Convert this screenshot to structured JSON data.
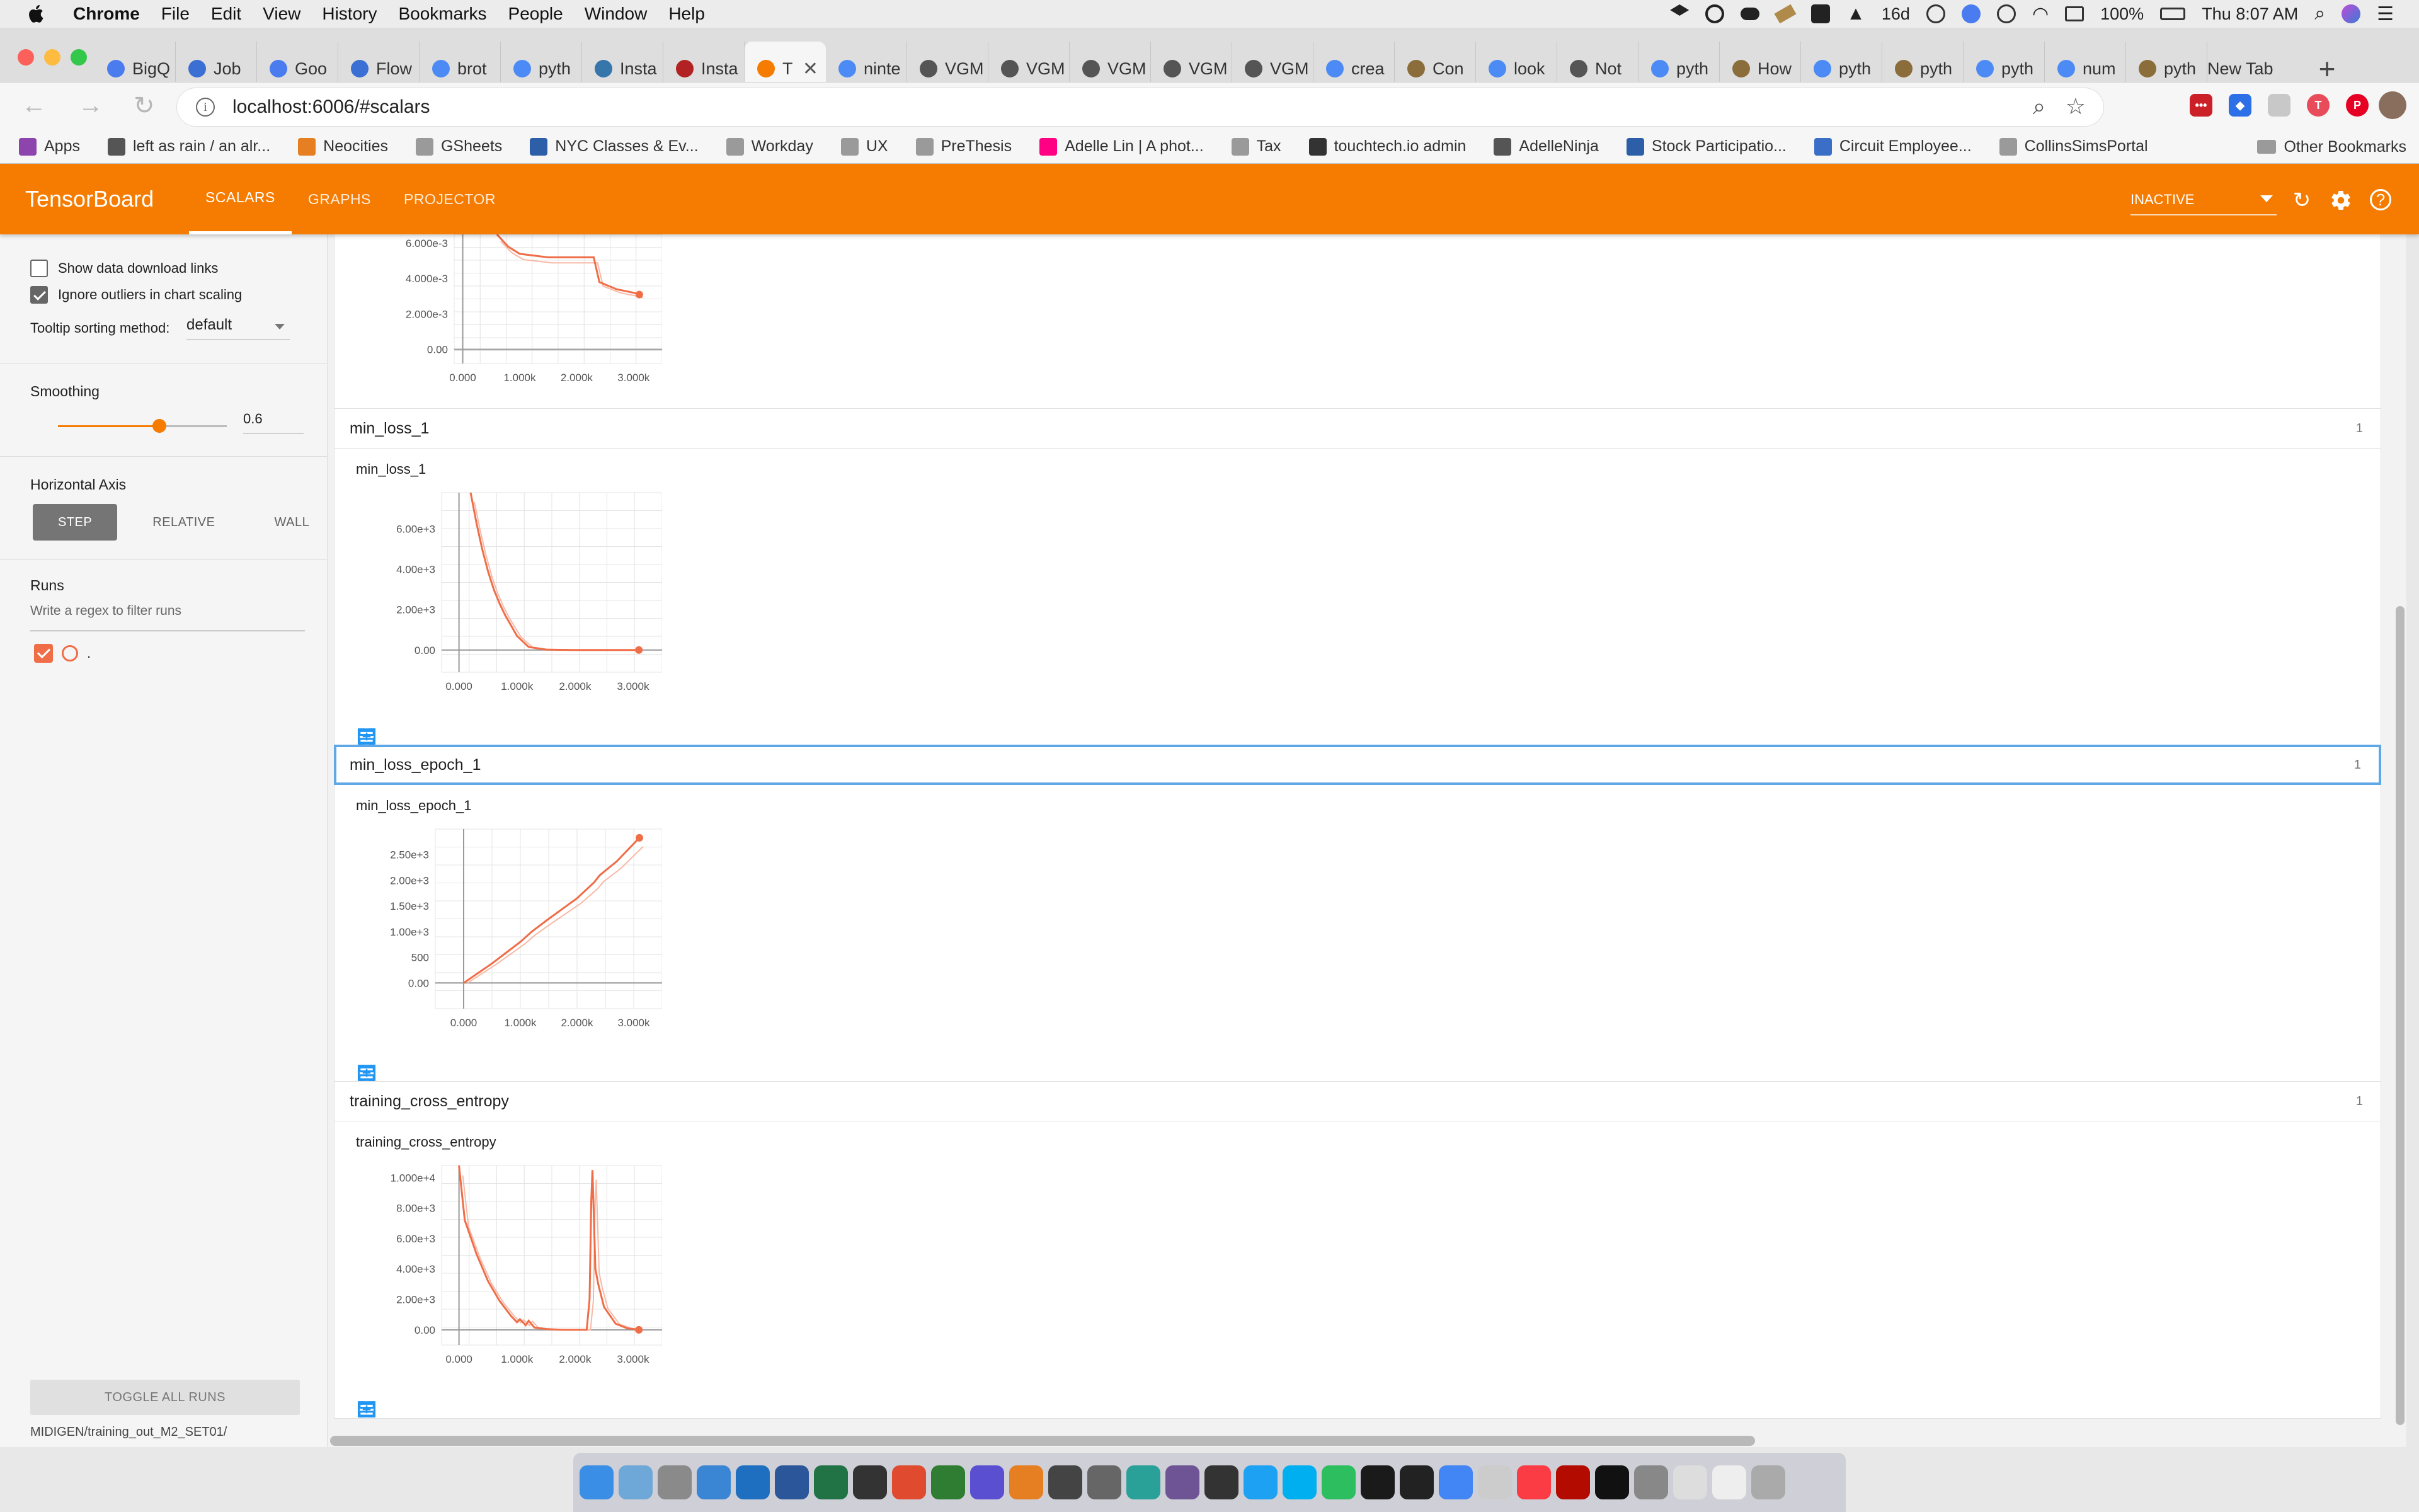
{
  "menubar": {
    "app": "Chrome",
    "items": [
      "File",
      "Edit",
      "View",
      "History",
      "Bookmarks",
      "People",
      "Window",
      "Help"
    ],
    "tray_text": "16d",
    "battery": "100%",
    "clock": "Thu 8:07 AM"
  },
  "tabs": [
    {
      "title": "BigQ",
      "color": "#4a7cf0"
    },
    {
      "title": "Job",
      "color": "#3b6fd4"
    },
    {
      "title": "Goo",
      "color": "#4a7cf0"
    },
    {
      "title": "Flow",
      "color": "#3b6fd4"
    },
    {
      "title": "brot",
      "color": "#4c8bf5"
    },
    {
      "title": "pyth",
      "color": "#4c8bf5"
    },
    {
      "title": "Insta",
      "color": "#3776ab"
    },
    {
      "title": "Insta",
      "color": "#b22222"
    },
    {
      "title": "T",
      "color": "#f57c00",
      "active": true
    },
    {
      "title": "ninte",
      "color": "#4c8bf5"
    },
    {
      "title": "VGM",
      "color": "#555555"
    },
    {
      "title": "VGM",
      "color": "#555555"
    },
    {
      "title": "VGM",
      "color": "#555555"
    },
    {
      "title": "VGM",
      "color": "#555555"
    },
    {
      "title": "VGM",
      "color": "#555555"
    },
    {
      "title": "crea",
      "color": "#4c8bf5"
    },
    {
      "title": "Con",
      "color": "#8a6d3b"
    },
    {
      "title": "look",
      "color": "#4c8bf5"
    },
    {
      "title": "Not",
      "color": "#555555"
    },
    {
      "title": "pyth",
      "color": "#4c8bf5"
    },
    {
      "title": "How",
      "color": "#8a6d3b"
    },
    {
      "title": "pyth",
      "color": "#4c8bf5"
    },
    {
      "title": "pyth",
      "color": "#8a6d3b"
    },
    {
      "title": "pyth",
      "color": "#4c8bf5"
    },
    {
      "title": "num",
      "color": "#4c8bf5"
    },
    {
      "title": "pyth",
      "color": "#8a6d3b"
    }
  ],
  "new_tab_label": "New Tab",
  "address": {
    "url": "localhost:6006/#scalars"
  },
  "bookmarks": {
    "items": [
      {
        "label": "Apps",
        "color": "#8e44ad"
      },
      {
        "label": "left as rain / an alr...",
        "color": "#555555"
      },
      {
        "label": "Neocities",
        "color": "#e67e22"
      },
      {
        "label": "GSheets",
        "color": "#9a9a9a"
      },
      {
        "label": "NYC Classes & Ev...",
        "color": "#2c5fa8"
      },
      {
        "label": "Workday",
        "color": "#9a9a9a"
      },
      {
        "label": "UX",
        "color": "#9a9a9a"
      },
      {
        "label": "PreThesis",
        "color": "#9a9a9a"
      },
      {
        "label": "Adelle Lin | A phot...",
        "color": "#ff0084"
      },
      {
        "label": "Tax",
        "color": "#9a9a9a"
      },
      {
        "label": "touchtech.io admin",
        "color": "#333333"
      },
      {
        "label": "AdelleNinja",
        "color": "#555555"
      },
      {
        "label": "Stock Participatio...",
        "color": "#2c5fa8"
      },
      {
        "label": "Circuit Employee...",
        "color": "#3a6ec7"
      },
      {
        "label": "CollinsSimsPortal",
        "color": "#9a9a9a"
      }
    ],
    "other": "Other Bookmarks"
  },
  "tensorboard": {
    "brand": "TensorBoard",
    "tabs": [
      "SCALARS",
      "GRAPHS",
      "PROJECTOR"
    ],
    "status_select": "INACTIVE"
  },
  "sidebar": {
    "show_download_links": "Show data download links",
    "ignore_outliers": "Ignore outliers in chart scaling",
    "tooltip_label": "Tooltip sorting method:",
    "tooltip_value": "default",
    "smoothing_label": "Smoothing",
    "smoothing_value": "0.6",
    "smoothing_fraction": 0.6,
    "horizontal_axis_label": "Horizontal Axis",
    "axis_options": [
      "STEP",
      "RELATIVE",
      "WALL"
    ],
    "runs_label": "Runs",
    "runs_filter_placeholder": "Write a regex to filter runs",
    "run_name": ".",
    "toggle_all": "TOGGLE ALL RUNS",
    "logdir": "MIDIGEN/training_out_M2_SET01/"
  },
  "colors": {
    "accent": "#f57c00",
    "series": "#ef6d47",
    "series_raw": "#f7b9a6",
    "focus": "#5fa8e8"
  },
  "groups": [
    {
      "name": "min_loss_1",
      "count": "1"
    },
    {
      "name": "min_loss_epoch_1",
      "count": "1"
    },
    {
      "name": "training_cross_entropy",
      "count": "1"
    }
  ],
  "chart_data": [
    {
      "type": "line",
      "title": "",
      "partial": true,
      "x_ticks": [
        "0.000",
        "1.000k",
        "2.000k",
        "3.000k"
      ],
      "y_ticks": [
        "0.00",
        "2.000e-3",
        "4.000e-3",
        "6.000e-3"
      ],
      "xlim": [
        -150,
        3500
      ],
      "ylim": [
        -0.0008,
        0.0065
      ],
      "series": [
        {
          "x": [
            600,
            800,
            1000,
            1500,
            2000,
            2300,
            2400,
            2700,
            3000,
            3100
          ],
          "y": [
            0.0065,
            0.0058,
            0.0054,
            0.0052,
            0.0052,
            0.0052,
            0.0038,
            0.0034,
            0.0032,
            0.0031
          ]
        }
      ]
    },
    {
      "type": "line",
      "title": "min_loss_1",
      "x_ticks": [
        "0.000",
        "1.000k",
        "2.000k",
        "3.000k"
      ],
      "y_ticks": [
        "0.00",
        "2.00e+3",
        "4.00e+3",
        "6.00e+3"
      ],
      "xlim": [
        -300,
        3500
      ],
      "ylim": [
        -1100,
        7800
      ],
      "series": [
        {
          "x": [
            200,
            300,
            400,
            500,
            600,
            700,
            800,
            900,
            1000,
            1200,
            1500,
            2000,
            2500,
            3100
          ],
          "y": [
            7800,
            6300,
            5000,
            3900,
            3000,
            2300,
            1700,
            1200,
            700,
            150,
            20,
            0,
            0,
            0
          ]
        }
      ]
    },
    {
      "type": "line",
      "title": "min_loss_epoch_1",
      "x_ticks": [
        "0.000",
        "1.000k",
        "2.000k",
        "3.000k"
      ],
      "y_ticks": [
        "0.00",
        "500",
        "1.00e+3",
        "1.50e+3",
        "2.00e+3",
        "2.50e+3"
      ],
      "xlim": [
        -500,
        3500
      ],
      "ylim": [
        -500,
        3000
      ],
      "series": [
        {
          "x": [
            0,
            500,
            1000,
            1200,
            1500,
            2000,
            2300,
            2400,
            2700,
            3100
          ],
          "y": [
            0,
            380,
            800,
            1000,
            1250,
            1650,
            1960,
            2100,
            2370,
            2830
          ]
        }
      ]
    },
    {
      "type": "line",
      "title": "training_cross_entropy",
      "x_ticks": [
        "0.000",
        "1.000k",
        "2.000k",
        "3.000k"
      ],
      "y_ticks": [
        "0.00",
        "2.00e+3",
        "4.00e+3",
        "6.00e+3",
        "8.00e+3",
        "1.000e+4"
      ],
      "xlim": [
        -300,
        3500
      ],
      "ylim": [
        -1000,
        10800
      ],
      "series": [
        {
          "x": [
            0,
            100,
            300,
            500,
            700,
            900,
            1000,
            1050,
            1150,
            1200,
            1300,
            1500,
            1800,
            2100,
            2200,
            2250,
            2280,
            2300,
            2350,
            2400,
            2500,
            2700,
            2900,
            3100
          ],
          "y": [
            10800,
            7200,
            5000,
            3200,
            1900,
            900,
            500,
            700,
            300,
            600,
            150,
            50,
            0,
            0,
            0,
            2000,
            8500,
            10500,
            4000,
            3000,
            1500,
            400,
            100,
            0
          ]
        }
      ]
    }
  ]
}
